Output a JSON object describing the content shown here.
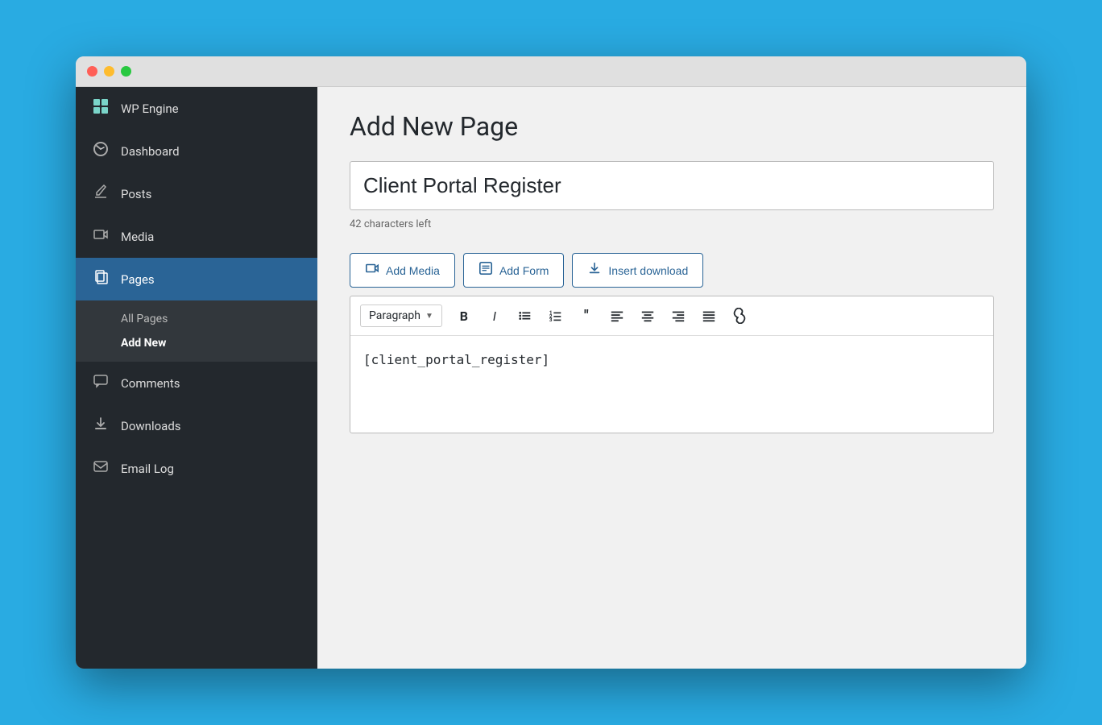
{
  "window": {
    "titlebar": {
      "dots": [
        "red",
        "yellow",
        "green"
      ]
    }
  },
  "sidebar": {
    "items": [
      {
        "id": "wp-engine",
        "label": "WP Engine",
        "icon": "⊞"
      },
      {
        "id": "dashboard",
        "label": "Dashboard",
        "icon": "🎨"
      },
      {
        "id": "posts",
        "label": "Posts",
        "icon": "📌"
      },
      {
        "id": "media",
        "label": "Media",
        "icon": "📷"
      },
      {
        "id": "pages",
        "label": "Pages",
        "icon": "📄",
        "active": true
      }
    ],
    "pages_submenu": [
      {
        "id": "all-pages",
        "label": "All Pages"
      },
      {
        "id": "add-new",
        "label": "Add New",
        "active": true
      }
    ],
    "bottom_items": [
      {
        "id": "comments",
        "label": "Comments",
        "icon": "💬"
      },
      {
        "id": "downloads",
        "label": "Downloads",
        "icon": "⬇"
      },
      {
        "id": "email-log",
        "label": "Email Log",
        "icon": "✉"
      }
    ]
  },
  "main": {
    "page_title": "Add New Page",
    "title_input_value": "Client Portal Register",
    "char_count": "42 characters left",
    "buttons": [
      {
        "id": "add-media",
        "label": "Add Media",
        "icon": "📷"
      },
      {
        "id": "add-form",
        "label": "Add Form",
        "icon": "📋"
      },
      {
        "id": "insert-download",
        "label": "Insert download",
        "icon": "⬇"
      }
    ],
    "toolbar": {
      "format_label": "Paragraph",
      "buttons": [
        "B",
        "I",
        "•",
        "½",
        "❝",
        "≡",
        "≡",
        "≡",
        "🔗"
      ]
    },
    "editor": {
      "content": "[client_portal_register]"
    }
  }
}
